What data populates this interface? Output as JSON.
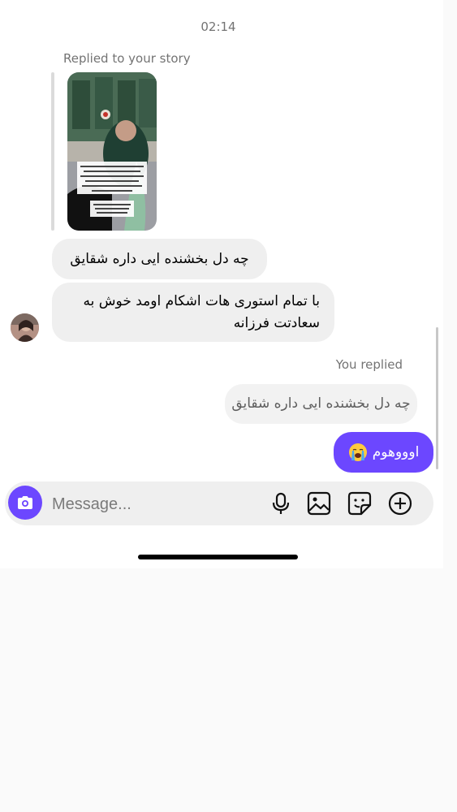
{
  "conversation": {
    "timestamp": "02:14",
    "story_reply_label": "Replied to your story",
    "incoming": [
      {
        "text": "چه دل بخشنده ایی داره شقایق"
      },
      {
        "text": "با تمام استوری هات اشکام اومد خوش به سعادتت فرزانه"
      }
    ],
    "you_replied_label": "You replied",
    "quoted_reply": "چه دل بخشنده ایی داره شقایق",
    "outgoing": {
      "text": "اوووهوم"
    }
  },
  "composer": {
    "placeholder": "Message...",
    "icons": [
      "camera-icon",
      "microphone-icon",
      "gallery-icon",
      "sticker-icon",
      "add-icon"
    ]
  },
  "colors": {
    "accent": "#6c47ff",
    "incoming_bubble": "#efefef",
    "meta_text": "#737373"
  }
}
